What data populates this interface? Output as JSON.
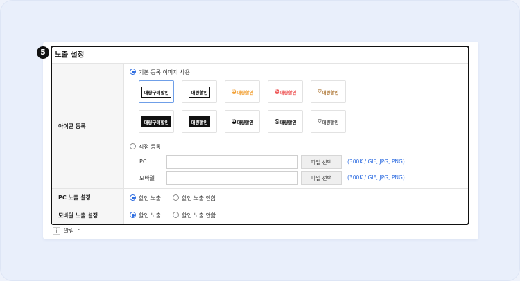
{
  "section": {
    "step_number": "5",
    "title": "노출 설정"
  },
  "icon_register": {
    "label": "아이콘 등록",
    "default_option": "기본 등록 이미지 사용",
    "default_selected": true,
    "icons_row1": [
      {
        "text": "대량구매할인",
        "style": "box-light",
        "selected": true
      },
      {
        "text": "대량할인",
        "style": "box-light",
        "selected": false
      },
      {
        "text": "대량할인",
        "style": "dot-orange",
        "selected": false
      },
      {
        "text": "대량할인",
        "style": "dot-red",
        "selected": false
      },
      {
        "text": "대량할인",
        "style": "tag-brown",
        "selected": false
      }
    ],
    "icons_row2": [
      {
        "text": "대량구매할인",
        "style": "box-dark"
      },
      {
        "text": "대량할인",
        "style": "box-dark"
      },
      {
        "text": "대량할인",
        "style": "dot-black"
      },
      {
        "text": "대량할인",
        "style": "dot-outline"
      },
      {
        "text": "대량할인",
        "style": "tag-gray"
      }
    ],
    "custom_option": "직접 등록",
    "custom_selected": false,
    "pc_label": "PC",
    "mobile_label": "모바일",
    "pc_value": "",
    "mobile_value": "",
    "file_button": "파일 선택",
    "file_hint": "(300K / GIF, JPG, PNG)"
  },
  "pc_exposure": {
    "label": "PC 노출 설정",
    "option_on": "할인 노출",
    "option_off": "할인 노출 안함",
    "selected": "on"
  },
  "mobile_exposure": {
    "label": "모바일 노출 설정",
    "option_on": "할인 노출",
    "option_off": "할인 노출 안함",
    "selected": "on"
  },
  "notice": {
    "info_glyph": "i",
    "label": "알림"
  },
  "colors": {
    "accent": "#2a6ae0",
    "background": "#eef2fb",
    "orange": "#f2a33a",
    "red": "#ee5a5a",
    "brown": "#b07a3a"
  }
}
